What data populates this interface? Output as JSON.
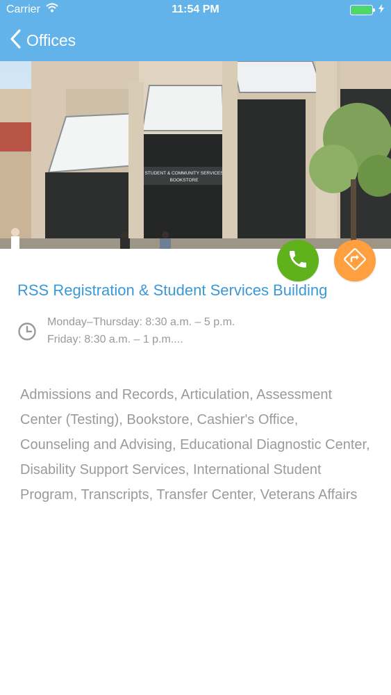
{
  "status_bar": {
    "carrier": "Carrier",
    "time": "11:54 PM"
  },
  "nav": {
    "back_label": "Offices"
  },
  "office": {
    "name": "RSS Registration & Student Services Building",
    "hours_line1": "Monday–Thursday: 8:30 a.m. – 5 p.m.",
    "hours_line2": "Friday: 8:30 a.m. – 1 p.m....",
    "description": "Admissions and Records, Articulation, Assessment Center (Testing), Bookstore, Cashier's Office, Counseling and Advising, Educational Diagnostic Center, Disability Support Services, International Student Program, Transcripts, Transfer Center, Veterans Affairs"
  },
  "photo": {
    "sign_line1": "STUDENT & COMMUNITY SERVICES",
    "sign_line2": "BOOKSTORE"
  },
  "colors": {
    "header": "#62b3e9",
    "title": "#3a98d7",
    "call": "#5fb21b",
    "directions": "#ff9f3f",
    "text_gray": "#9a9a9a"
  },
  "icons": {
    "call": "phone-icon",
    "directions": "directions-icon",
    "hours": "clock-icon",
    "back": "chevron-left-icon"
  }
}
